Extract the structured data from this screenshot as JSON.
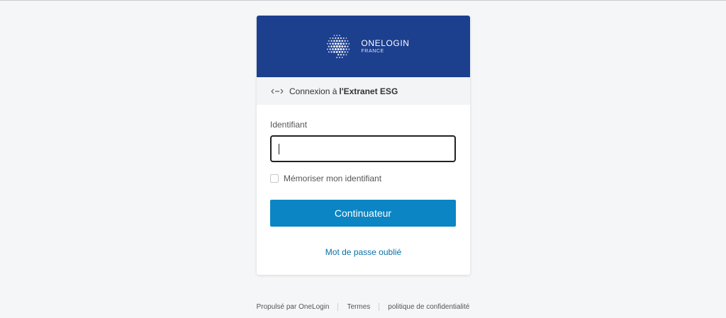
{
  "brand": {
    "name": "ONELOGIN",
    "subtitle": "FRANCE",
    "header_color": "#1c3f8e"
  },
  "app_bar": {
    "icon": "arrows-left-right-icon",
    "prefix": "Connexion à",
    "app_name": "l'Extranet ESG"
  },
  "form": {
    "username_label": "Identifiant",
    "username_value": "",
    "remember_label": "Mémoriser mon identifiant",
    "remember_checked": false,
    "continue_label": "Continuateur",
    "button_color": "#0b85c3",
    "forgot_label": "Mot de passe oublié"
  },
  "footer": {
    "powered_by": "Propulsé par OneLogin",
    "terms": "Termes",
    "privacy": "politique de confidentialité"
  }
}
